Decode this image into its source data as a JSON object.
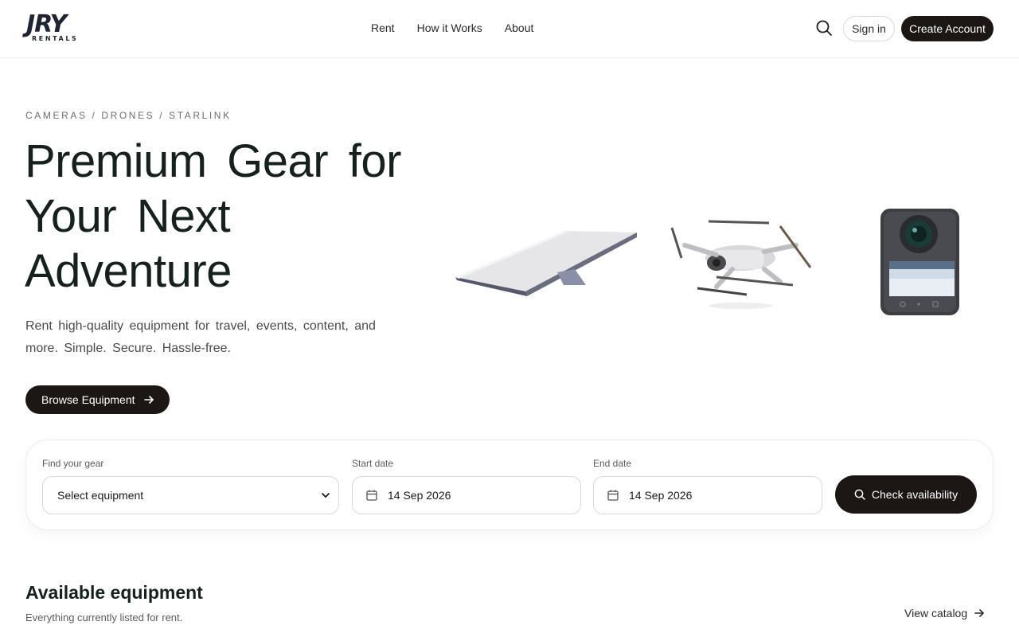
{
  "brand": {
    "logo_text": "JRY",
    "logo_sub": "RENTALS"
  },
  "nav": {
    "items": [
      {
        "label": "Rent"
      },
      {
        "label": "How it Works"
      },
      {
        "label": "About"
      }
    ]
  },
  "header": {
    "signin_label": "Sign in",
    "create_label": "Create Account",
    "search_icon": "search-icon"
  },
  "hero": {
    "breadcrumb": "CAMERAS / DRONES / STARLINK",
    "title": "Premium Gear for Your Next Adventure",
    "subtitle": "Rent high-quality equipment for travel, events, content, and more. Simple. Secure. Hassle-free.",
    "cta_label": "Browse Equipment"
  },
  "search": {
    "gear_label": "Find your gear",
    "gear_value": "Select equipment",
    "start_label": "Start date",
    "start_value": "14 Sep 2026",
    "end_label": "End date",
    "end_value": "14 Sep 2026",
    "check_label": "Check availability"
  },
  "available": {
    "title": "Available equipment",
    "subtitle": "Everything currently listed for rent.",
    "view_label": "View catalog"
  },
  "colors": {
    "primary_dark": "#1c1614",
    "heading": "#16201c",
    "border": "#d8d8d8"
  }
}
